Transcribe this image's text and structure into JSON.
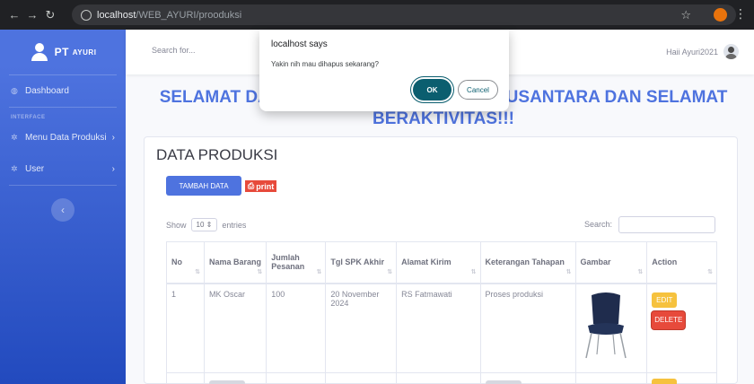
{
  "browser": {
    "url_host": "localhost",
    "url_path": "/WEB_AYURI/prooduksi"
  },
  "sidebar": {
    "brand_prefix": "PT",
    "brand_name": "AYURI",
    "items": [
      {
        "label": "Dashboard",
        "icon": "dashboard-icon"
      },
      {
        "label": "Menu Data Produksi",
        "icon": "gear-icon"
      },
      {
        "label": "User",
        "icon": "gear-icon"
      }
    ],
    "section_heading": "INTERFACE",
    "toggle_icon": "chevron-left-icon"
  },
  "topbar": {
    "search_placeholder": "Search for...",
    "user_greeting": "Haii Ayuri2021"
  },
  "welcome_heading": "SELAMAT DATANG DI PT AYURI KREASI NUSANTARA DAN SELAMAT BERAKTIVITAS!!!",
  "card": {
    "title": "DATA PRODUKSI",
    "add_button": "TAMBAH DATA",
    "print_button": "print",
    "show_label": "Show",
    "entries_value": "10",
    "entries_label": "entries",
    "search_label": "Search:"
  },
  "table": {
    "headers": [
      "No",
      "Nama Barang",
      "Jumlah Pesanan",
      "Tgl SPK Akhir",
      "Alamat Kirim",
      "Keterangan Tahapan",
      "Gambar",
      "Action"
    ],
    "rows": [
      {
        "no": "1",
        "nama_barang": "MK Oscar",
        "jumlah": "100",
        "tgl": "20 November 2024",
        "alamat": "RS Fatmawati",
        "keterangan": "Proses produksi",
        "edit": "EDIT",
        "delete": "DELETE"
      }
    ]
  },
  "dialog": {
    "title": "localhost says",
    "message": "Yakin nih mau dihapus sekarang?",
    "ok": "OK",
    "cancel": "Cancel"
  },
  "colors": {
    "primary": "#4e73df",
    "danger": "#e74a3b",
    "warning": "#f6c23e",
    "dialog_button": "#0b5e6f"
  }
}
